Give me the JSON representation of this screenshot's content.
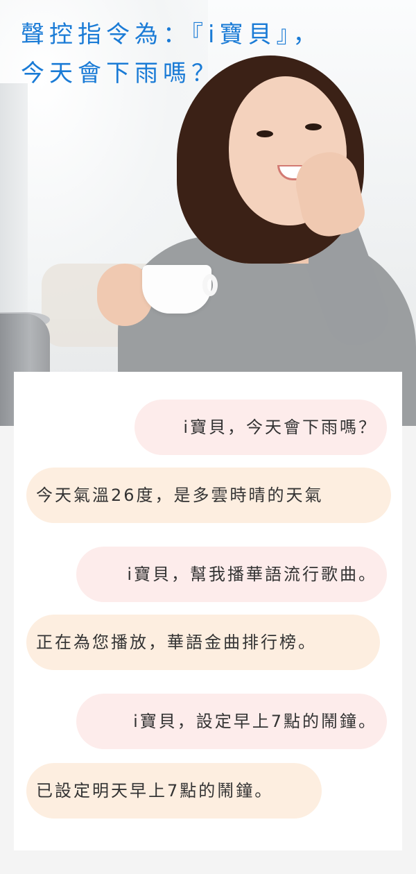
{
  "headline": {
    "line1": "聲控指令為：『i寶貝』，",
    "line2": "今天會下雨嗎？",
    "color": "#1a7bd6"
  },
  "hero": {
    "scene": "woman-holding-cup-next-to-smart-speaker"
  },
  "conversation": [
    {
      "speaker": "user",
      "text": "i寶貝，今天會下雨嗎？"
    },
    {
      "speaker": "assistant",
      "text": "今天氣溫26度，是多雲時晴的天氣"
    },
    {
      "speaker": "user",
      "text": "i寶貝，幫我播華語流行歌曲。"
    },
    {
      "speaker": "assistant",
      "text": "正在為您播放，華語金曲排行榜。"
    },
    {
      "speaker": "user",
      "text": "i寶貝，設定早上7點的鬧鐘。"
    },
    {
      "speaker": "assistant",
      "text": "已設定明天早上7點的鬧鐘。"
    }
  ],
  "colors": {
    "user_bubble": "#fdeceb",
    "assistant_bubble": "#fdeee0",
    "text": "#333333",
    "card": "#ffffff",
    "page": "#f4f4f4"
  }
}
